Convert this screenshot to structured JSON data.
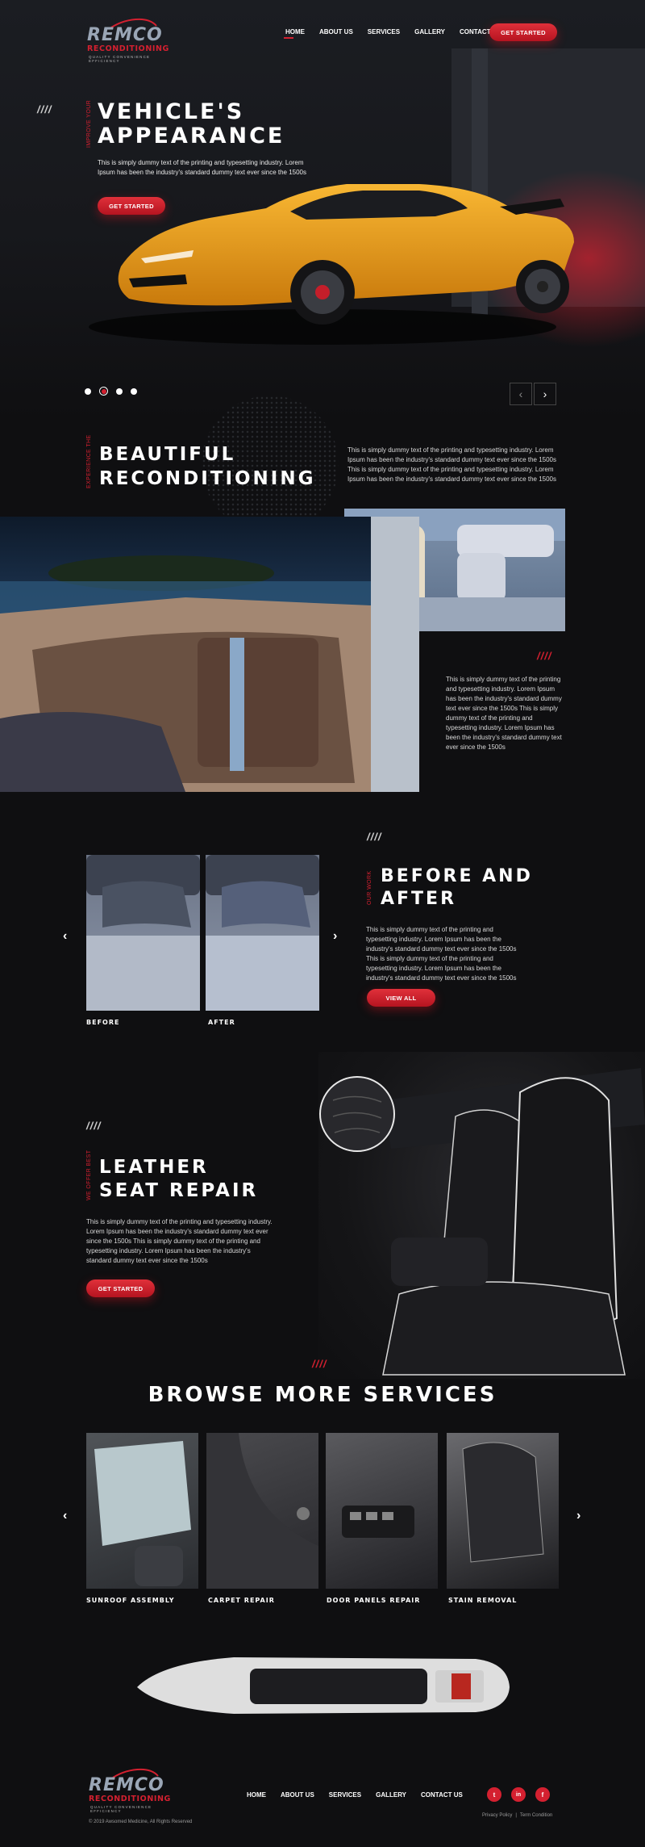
{
  "brand": {
    "name": "REMCO",
    "sub": "RECONDITIONING",
    "tagline": "Quality Convenience Efficiency"
  },
  "nav": {
    "items": [
      "HOME",
      "ABOUT US",
      "SERVICES",
      "GALLERY",
      "CONTACT US"
    ],
    "cta": "GET STARTED"
  },
  "hero": {
    "slashes": "////",
    "side_label": "IMPROVE YOUR",
    "title_line1": "VEHICLE'S",
    "title_line2": "APPEARANCE",
    "text": "This is simply dummy text of the printing and typesetting industry. Lorem Ipsum has been the industry's standard dummy text ever since the 1500s",
    "cta": "GET STARTED",
    "active_dot": 2,
    "prev_icon": "chevron-left-icon",
    "next_icon": "chevron-right-icon"
  },
  "recon": {
    "side_label": "EXPERIENCE THE",
    "title_line1": "BEAUTIFUL",
    "title_line2": "RECONDITIONING",
    "text": "This is simply dummy text of the printing and typesetting industry. Lorem Ipsum has been the industry's standard dummy text ever since the 1500s This is simply dummy text of the printing and typesetting industry. Lorem Ipsum has been the industry's standard dummy text ever since the 1500s",
    "slashes": "////",
    "text2": "This is simply dummy text of the printing and typesetting industry. Lorem Ipsum has been the industry's standard dummy text ever since the 1500s This is simply dummy text of the printing and typesetting industry. Lorem Ipsum has been the industry's standard dummy text ever since the 1500s"
  },
  "before_after": {
    "slashes": "////",
    "side_label": "OUR WORK",
    "title_line1": "BEFORE AND",
    "title_line2": "AFTER",
    "before_label": "BEFORE",
    "after_label": "AFTER",
    "text": "This is simply dummy text of the printing and typesetting industry. Lorem Ipsum has been the industry's standard dummy text ever since the 1500s This is simply dummy text of the printing and typesetting industry. Lorem Ipsum has been the industry's standard dummy text ever since the 1500s",
    "cta": "VIEW ALL"
  },
  "leather": {
    "slashes": "////",
    "side_label": "WE OFFER BEST",
    "title_line1": "LEATHER",
    "title_line2": "SEAT REPAIR",
    "text": "This is simply dummy text of the printing and typesetting industry. Lorem Ipsum has been the industry's standard dummy text ever since the 1500s This is simply dummy text of the printing and typesetting industry. Lorem Ipsum has been the industry's standard dummy text ever since the 1500s",
    "cta": "GET STARTED"
  },
  "services": {
    "slashes": "////",
    "title": "BROWSE MORE SERVICES",
    "cards": [
      "SUNROOF ASSEMBLY",
      "CARPET REPAIR",
      "DOOR PANELS REPAIR",
      "STAIN REMOVAL"
    ]
  },
  "footer": {
    "nav": [
      "HOME",
      "ABOUT US",
      "SERVICES",
      "GALLERY",
      "CONTACT US"
    ],
    "copyright": "© 2019 Awsomed Medicine, All Rights Reserved",
    "social": [
      "twitter-icon",
      "linkedin-icon",
      "facebook-icon"
    ],
    "social_glyphs": [
      "t",
      "in",
      "f"
    ],
    "links": [
      "Privacy Policy",
      "|",
      "Term Condition"
    ]
  },
  "colors": {
    "accent": "#d42030",
    "car": "#e9a01d",
    "background": "#0f0f11"
  }
}
